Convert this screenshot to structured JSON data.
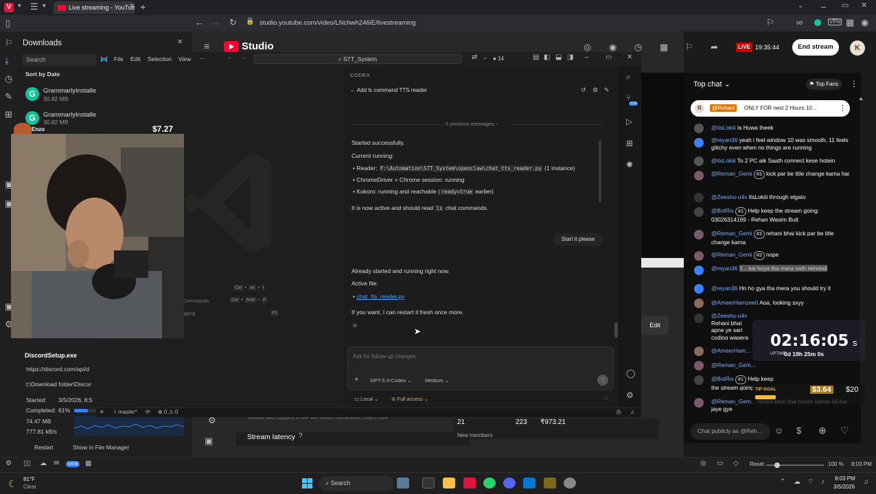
{
  "browser": {
    "tab_title": "Live streaming - YouTube S",
    "url": "studio.youtube.com/video/LNchwh246iE/livestreaming"
  },
  "downloads": {
    "title": "Downloads",
    "search_placeholder": "Search",
    "sort_label": "Sort by Date",
    "items": [
      {
        "name": "GrammarlyInstaller.",
        "size": "30.82 MB"
      },
      {
        "name": "GrammarlyInstaller.",
        "size": "30.82 MB"
      }
    ],
    "active": {
      "name": "DiscordSetup.exe",
      "url": "https://discord.com/api/d",
      "path": "t:\\Download folder\\Discor",
      "started_label": "Started:",
      "started_value": "3/5/2026, 8:5",
      "completed_label": "Completed:",
      "completed_value": "61%",
      "completed_fraction": 0.61,
      "size": "74.47 MB",
      "speed": "777.81 kB/s",
      "restart": "Restart",
      "show_in_manager": "Show in File Manager"
    }
  },
  "overlay": {
    "donation_amount": "$7.27",
    "donor_name": "Enzo"
  },
  "studio": {
    "brand": "Studio",
    "live_badge": "LIVE",
    "live_time": "19:35:44",
    "end_stream": "End stream",
    "avatar_letter": "K",
    "edit_label": "Edit",
    "stream_latency": "Stream latency",
    "stat_1": "21",
    "stat_2": "223",
    "stat_3": "₹973.21",
    "new_members": "New members",
    "faded_text": "Youtube also supports RTMP live secure connections. Learn more"
  },
  "vscode": {
    "menu": [
      "File",
      "Edit",
      "Selection",
      "View",
      "···"
    ],
    "search": "STT_System",
    "notif_count": "14",
    "shortcuts": [
      {
        "label": "t",
        "keys": [
          "Ctrl",
          "+",
          "Alt",
          "+",
          "I"
        ]
      },
      {
        "label": "Commands",
        "keys": [
          "Ctrl",
          "+",
          "Shift",
          "+",
          "P"
        ]
      },
      {
        "label": "gging",
        "keys": [
          "F5"
        ]
      }
    ],
    "status": {
      "branch": "master*",
      "problems": "⊗ 0 ⚠ 0"
    },
    "activity_badge": "123"
  },
  "codex": {
    "header": "CODEX",
    "back_title": "Add ls command TTS reader",
    "previous": "5 previous messages",
    "msg1": {
      "line1": "Started successfully.",
      "line2": "Current running:",
      "reader_label": "Reader:",
      "reader_path": "F:\\Automation\\STT_System\\openclaw\\chat_tts_reader.py",
      "reader_suffix": "(1 instance)",
      "chrome": "ChromeDriver + Chrome session: running",
      "kokoro_prefix": "Kokoro: running and reachable (",
      "kokoro_code": "ready=true",
      "kokoro_suffix": "earlier)",
      "active_prefix": "It is now active and should read",
      "active_code": "ls",
      "active_suffix": "chat commands."
    },
    "user_bubble": "Start it please",
    "msg2": {
      "line1": "Already started and running right now.",
      "line2": "Active file:",
      "file_link": "chat_tts_reader.py",
      "line3": "If you want, I can restart it fresh once more."
    },
    "input_placeholder": "Ask for follow-up changes",
    "model": "GPT-5.3-Codex",
    "effort": "Medium",
    "env": "Local",
    "access": "Full access"
  },
  "chat": {
    "header": "Top chat",
    "top_fans": "Top Fans",
    "pinned": {
      "author": "@Rehani",
      "text": "ONLY FOR next 2 Hours 10..."
    },
    "messages": [
      {
        "author": "@itsLokiii",
        "text": "Is Huwa theek"
      },
      {
        "author": "@reyan36",
        "text": "yeah i feel window 10 was smooth, 11 feels glitchy even when no things are running"
      },
      {
        "author": "@itsLokiii",
        "text": "To 2 PC aik Saath connect kese hotein"
      },
      {
        "author": "@Reman_Gemi",
        "badge": "#3",
        "text": "kick par be title change kama hai"
      },
      {
        "author": "@Zeeshu-u4v",
        "text": "ItsLokiii through elgato"
      },
      {
        "author": "@BotRix",
        "badge": "#1",
        "text": "Help keep the stream going: 03026314169 - Rehan Wasim Butt"
      },
      {
        "author": "@Reman_Gemi",
        "badge": "#3",
        "text": "rehani bhai kick par be title change karna"
      },
      {
        "author": "@Reman_Gemi",
        "badge": "#3",
        "text": "nope"
      },
      {
        "author": "@reyan36",
        "text": "Y... kai hoya tha mera sath reinstall"
      },
      {
        "author": "@reyan36",
        "text": "Hn ho gya tha mera you should try it"
      },
      {
        "author": "@AmeerHamzee0",
        "text": "Aoa, looking sxyy"
      },
      {
        "author": "@Zeeshu-u4v",
        "text": "Rehani bhai apne ye sari coding wagera kahan ... gude bata de ... hota and wha..."
      },
      {
        "author": "@AmeerHam...",
        "text": ""
      },
      {
        "author": "@Reman_Gem...",
        "text": ""
      },
      {
        "author": "@BotRix",
        "badge": "#1",
        "text": "Help keep the stream going: 03026314169"
      },
      {
        "author": "@Reman_Gem...",
        "text": "rehani bhai itna husan kahan lai kar jaye gye"
      }
    ],
    "input_placeholder": "Chat publicly as @Reh..."
  },
  "timer": {
    "time": "02:16:05",
    "suffix": "s",
    "uptime_label": "UPTIME",
    "uptime_value": "0d 19h 25m 0s"
  },
  "tip": {
    "label": "TIP GOAL",
    "current": "$3.64",
    "goal": "$20"
  },
  "bottom_status": {
    "network_badge": "5608",
    "reset": "Reset",
    "zoom": "100 %",
    "time": "8:03 PM"
  },
  "taskbar": {
    "weather_temp": "81°F",
    "weather_desc": "Clear",
    "search": "Search",
    "time": "8:03 PM",
    "date": "3/5/2026"
  }
}
